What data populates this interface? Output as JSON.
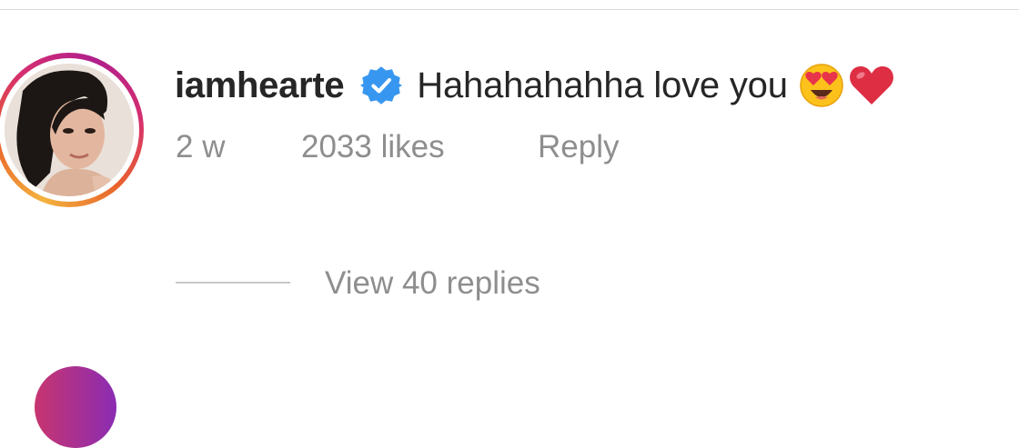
{
  "comment": {
    "username": "iamhearte",
    "verified_icon": "verified-badge-icon",
    "text": "Hahahahahha love you",
    "emojis": [
      "heart-eyes-emoji",
      "red-heart-emoji"
    ],
    "time": "2 w",
    "likes": "2033 likes",
    "reply_label": "Reply"
  },
  "replies": {
    "label": "View 40 replies"
  },
  "colors": {
    "text_primary": "#262626",
    "text_secondary": "#8e8e8e",
    "verified_blue": "#3797f0",
    "story_ring": [
      "#f4b23e",
      "#e8632b",
      "#d62e6f",
      "#b01f8d"
    ]
  }
}
